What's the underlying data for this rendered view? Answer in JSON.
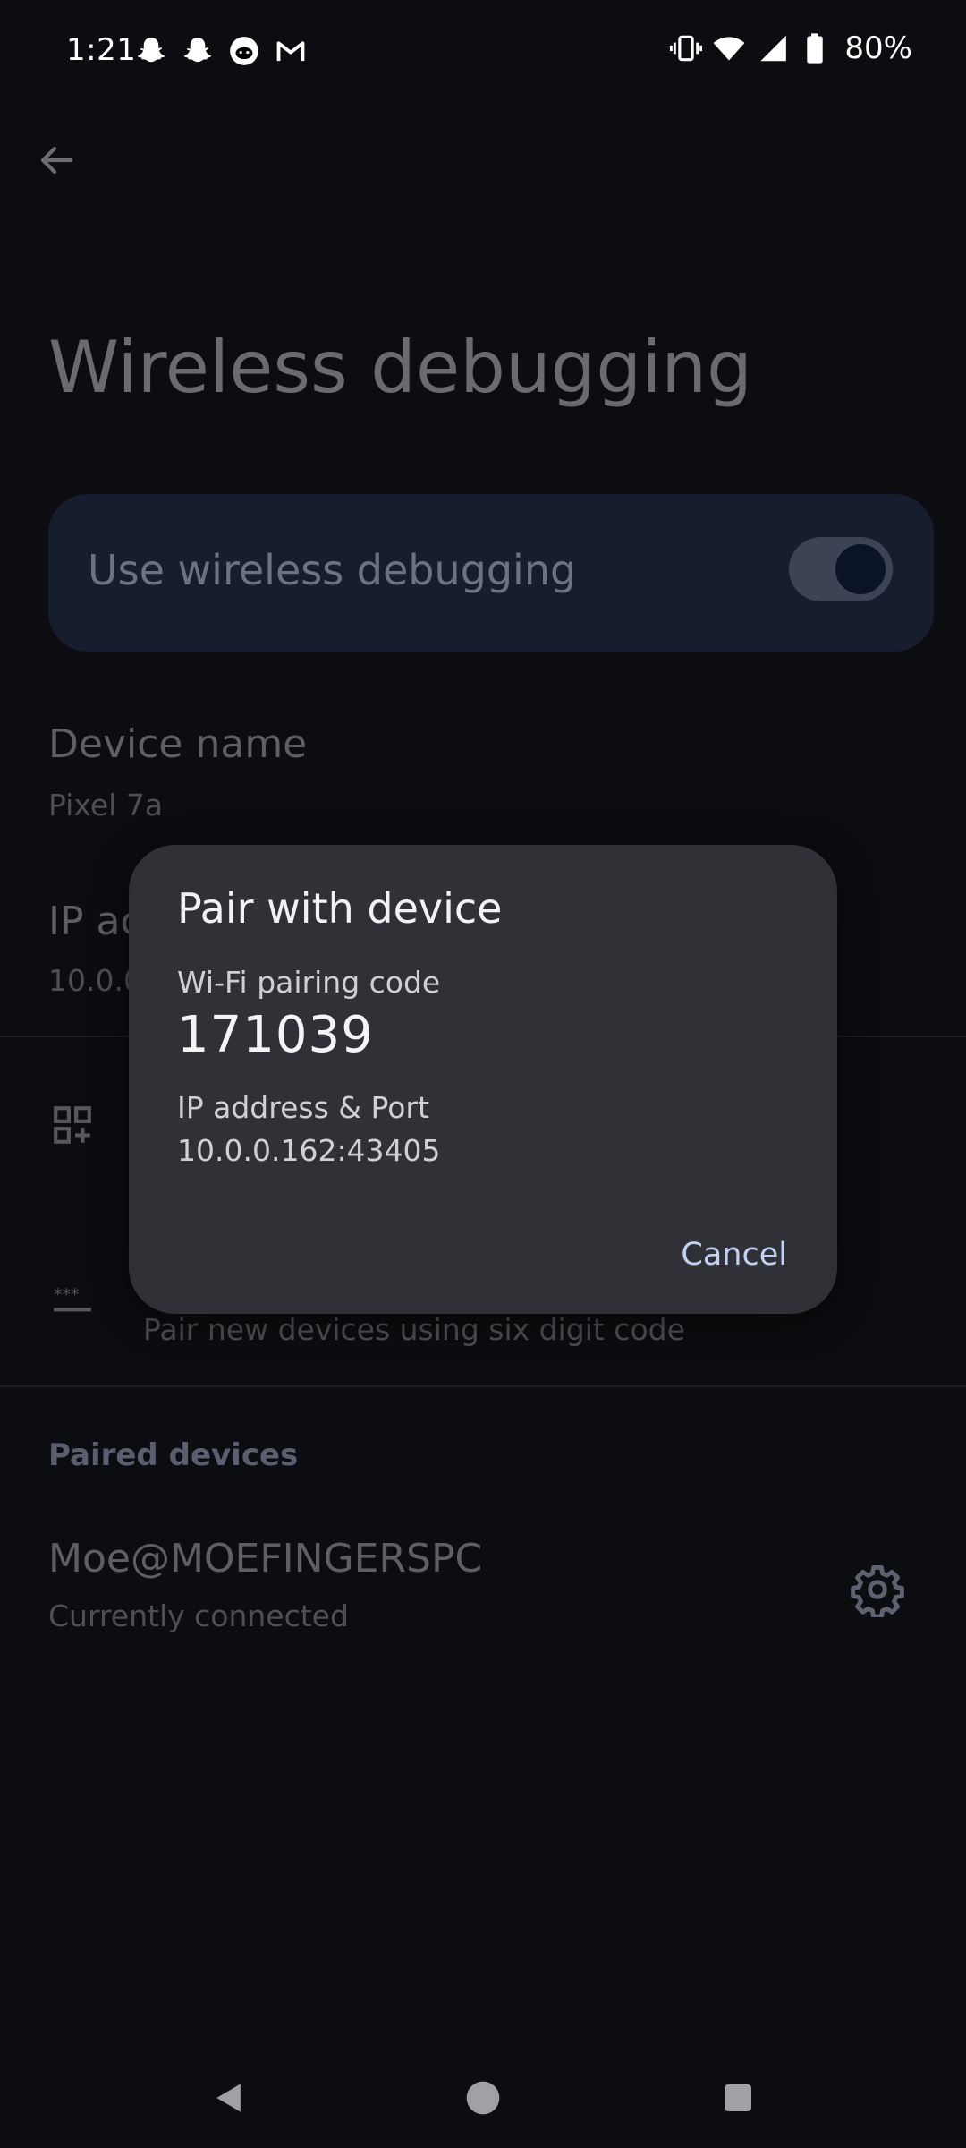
{
  "status_bar": {
    "time": "1:21",
    "notification_icons": [
      "snapchat-icon",
      "snapchat-icon",
      "reddit-icon",
      "gmail-icon"
    ],
    "system_icons": [
      "vibrate-icon",
      "wifi-icon",
      "signal-icon",
      "battery-icon"
    ],
    "battery": "80%"
  },
  "page": {
    "title": "Wireless debugging",
    "main_switch": {
      "label": "Use wireless debugging",
      "checked": true
    },
    "device_name": {
      "title": "Device name",
      "value": "Pixel 7a"
    },
    "ip_address": {
      "title_visible": "IP ac",
      "value_visible": "10.0.0"
    },
    "pair_with_code": {
      "summary": "Pair new devices using six digit code"
    },
    "paired_devices": {
      "category": "Paired devices",
      "items": [
        {
          "name": "Moe@MOEFINGERSPC",
          "status": "Currently connected"
        }
      ]
    }
  },
  "dialog": {
    "title": "Pair with device",
    "code_label": "Wi-Fi pairing code",
    "code": "171039",
    "address_label": "IP address & Port",
    "address": "10.0.0.162:43405",
    "cancel_label": "Cancel"
  },
  "colors": {
    "background": "#0c0d10",
    "dialog": "#303136",
    "accent": "#c3d1f5",
    "switch_card": "#161d2e"
  },
  "nav_bar": {
    "buttons": [
      "back-icon",
      "home-icon",
      "recents-icon"
    ]
  }
}
